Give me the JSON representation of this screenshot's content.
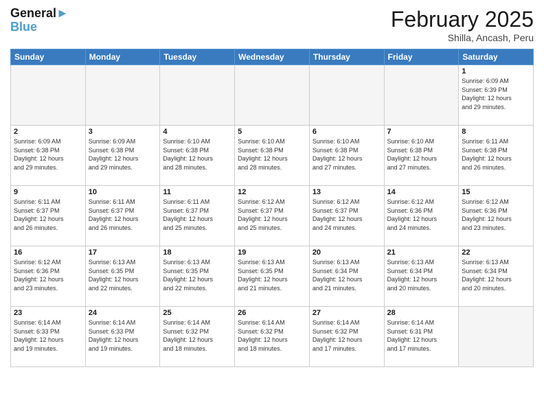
{
  "header": {
    "logo_general": "General",
    "logo_blue": "Blue",
    "title": "February 2025",
    "subtitle": "Shilla, Ancash, Peru"
  },
  "days_of_week": [
    "Sunday",
    "Monday",
    "Tuesday",
    "Wednesday",
    "Thursday",
    "Friday",
    "Saturday"
  ],
  "weeks": [
    [
      {
        "num": "",
        "info": ""
      },
      {
        "num": "",
        "info": ""
      },
      {
        "num": "",
        "info": ""
      },
      {
        "num": "",
        "info": ""
      },
      {
        "num": "",
        "info": ""
      },
      {
        "num": "",
        "info": ""
      },
      {
        "num": "1",
        "info": "Sunrise: 6:09 AM\nSunset: 6:39 PM\nDaylight: 12 hours\nand 29 minutes."
      }
    ],
    [
      {
        "num": "2",
        "info": "Sunrise: 6:09 AM\nSunset: 6:38 PM\nDaylight: 12 hours\nand 29 minutes."
      },
      {
        "num": "3",
        "info": "Sunrise: 6:09 AM\nSunset: 6:38 PM\nDaylight: 12 hours\nand 29 minutes."
      },
      {
        "num": "4",
        "info": "Sunrise: 6:10 AM\nSunset: 6:38 PM\nDaylight: 12 hours\nand 28 minutes."
      },
      {
        "num": "5",
        "info": "Sunrise: 6:10 AM\nSunset: 6:38 PM\nDaylight: 12 hours\nand 28 minutes."
      },
      {
        "num": "6",
        "info": "Sunrise: 6:10 AM\nSunset: 6:38 PM\nDaylight: 12 hours\nand 27 minutes."
      },
      {
        "num": "7",
        "info": "Sunrise: 6:10 AM\nSunset: 6:38 PM\nDaylight: 12 hours\nand 27 minutes."
      },
      {
        "num": "8",
        "info": "Sunrise: 6:11 AM\nSunset: 6:38 PM\nDaylight: 12 hours\nand 26 minutes."
      }
    ],
    [
      {
        "num": "9",
        "info": "Sunrise: 6:11 AM\nSunset: 6:37 PM\nDaylight: 12 hours\nand 26 minutes."
      },
      {
        "num": "10",
        "info": "Sunrise: 6:11 AM\nSunset: 6:37 PM\nDaylight: 12 hours\nand 26 minutes."
      },
      {
        "num": "11",
        "info": "Sunrise: 6:11 AM\nSunset: 6:37 PM\nDaylight: 12 hours\nand 25 minutes."
      },
      {
        "num": "12",
        "info": "Sunrise: 6:12 AM\nSunset: 6:37 PM\nDaylight: 12 hours\nand 25 minutes."
      },
      {
        "num": "13",
        "info": "Sunrise: 6:12 AM\nSunset: 6:37 PM\nDaylight: 12 hours\nand 24 minutes."
      },
      {
        "num": "14",
        "info": "Sunrise: 6:12 AM\nSunset: 6:36 PM\nDaylight: 12 hours\nand 24 minutes."
      },
      {
        "num": "15",
        "info": "Sunrise: 6:12 AM\nSunset: 6:36 PM\nDaylight: 12 hours\nand 23 minutes."
      }
    ],
    [
      {
        "num": "16",
        "info": "Sunrise: 6:12 AM\nSunset: 6:36 PM\nDaylight: 12 hours\nand 23 minutes."
      },
      {
        "num": "17",
        "info": "Sunrise: 6:13 AM\nSunset: 6:35 PM\nDaylight: 12 hours\nand 22 minutes."
      },
      {
        "num": "18",
        "info": "Sunrise: 6:13 AM\nSunset: 6:35 PM\nDaylight: 12 hours\nand 22 minutes."
      },
      {
        "num": "19",
        "info": "Sunrise: 6:13 AM\nSunset: 6:35 PM\nDaylight: 12 hours\nand 21 minutes."
      },
      {
        "num": "20",
        "info": "Sunrise: 6:13 AM\nSunset: 6:34 PM\nDaylight: 12 hours\nand 21 minutes."
      },
      {
        "num": "21",
        "info": "Sunrise: 6:13 AM\nSunset: 6:34 PM\nDaylight: 12 hours\nand 20 minutes."
      },
      {
        "num": "22",
        "info": "Sunrise: 6:13 AM\nSunset: 6:34 PM\nDaylight: 12 hours\nand 20 minutes."
      }
    ],
    [
      {
        "num": "23",
        "info": "Sunrise: 6:14 AM\nSunset: 6:33 PM\nDaylight: 12 hours\nand 19 minutes."
      },
      {
        "num": "24",
        "info": "Sunrise: 6:14 AM\nSunset: 6:33 PM\nDaylight: 12 hours\nand 19 minutes."
      },
      {
        "num": "25",
        "info": "Sunrise: 6:14 AM\nSunset: 6:32 PM\nDaylight: 12 hours\nand 18 minutes."
      },
      {
        "num": "26",
        "info": "Sunrise: 6:14 AM\nSunset: 6:32 PM\nDaylight: 12 hours\nand 18 minutes."
      },
      {
        "num": "27",
        "info": "Sunrise: 6:14 AM\nSunset: 6:32 PM\nDaylight: 12 hours\nand 17 minutes."
      },
      {
        "num": "28",
        "info": "Sunrise: 6:14 AM\nSunset: 6:31 PM\nDaylight: 12 hours\nand 17 minutes."
      },
      {
        "num": "",
        "info": ""
      }
    ]
  ]
}
